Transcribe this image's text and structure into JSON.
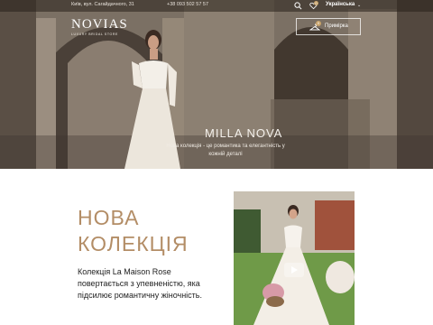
{
  "topbar": {
    "address": "Київ, вул. Сагайдачного, 31",
    "phone": "+38 093 502 57 57",
    "wishlist_count": "0",
    "language": "Українська"
  },
  "logo": {
    "name": "NOVIAS",
    "tagline": "LUXURY BRIDAL STORE"
  },
  "fitting": {
    "label": "Примірка",
    "count": "0"
  },
  "hero": {
    "title": "MILLA NOVA",
    "caption": "Нова колекція - це романтика та елегантність у кожній деталі"
  },
  "collection": {
    "title_line1": "НОВА",
    "title_line2": "КОЛЕКЦІЯ",
    "text": "Колекція La Maison Rose повертається з упевненістю, яка підсилює романтичну жіночність."
  },
  "colors": {
    "accent": "#b38d66",
    "badge": "#c9a46b"
  }
}
